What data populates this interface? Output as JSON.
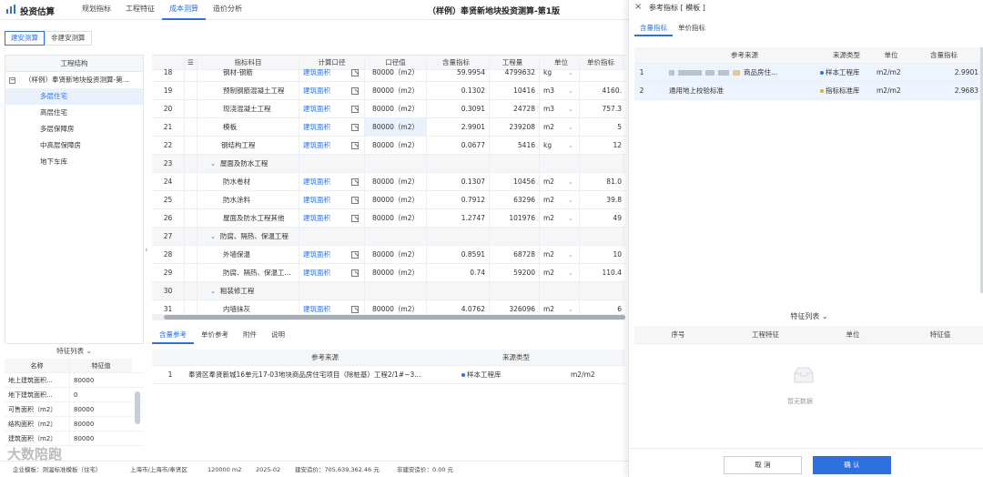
{
  "app": {
    "title": "投资估算",
    "nav": [
      "规划指标",
      "工程特征",
      "成本测算",
      "造价分析"
    ],
    "active_nav": 2,
    "doc_title": "（样例）奉贤新地块投资测算-第1版"
  },
  "subtabs": [
    "建安测算",
    "非建安测算"
  ],
  "tree": {
    "header": "工程结构",
    "root": "（样例）奉贤新地块投资测算-第...",
    "children": [
      "多层住宅",
      "高层住宅",
      "多层保障房",
      "中高层保障房",
      "地下车库"
    ]
  },
  "features": {
    "title": "特征列表",
    "col_name": "名称",
    "col_value": "特征值",
    "rows": [
      {
        "name": "地上建筑面积...",
        "value": "80000"
      },
      {
        "name": "地下建筑面积...",
        "value": "0"
      },
      {
        "name": "可售面积（m2）",
        "value": "80000"
      },
      {
        "name": "结构面积（m2）",
        "value": "80000"
      },
      {
        "name": "建筑面积（m2）",
        "value": "80000"
      }
    ]
  },
  "grid": {
    "headers": {
      "menu": "☰",
      "name": "指标科目",
      "calc": "计算口径",
      "value": "口径值",
      "index": "含量指标",
      "qty": "工程量",
      "unit": "单位",
      "price": "单价指标"
    },
    "rows": [
      {
        "no": "18",
        "name": "钢材-钢筋",
        "level": "lvl3",
        "calc": "建筑面积",
        "value": "80000（m2）",
        "index": "59.9954",
        "qty": "4799632",
        "unit": "kg",
        "price": ""
      },
      {
        "no": "19",
        "name": "预制钢筋混凝土工程",
        "level": "lvl3",
        "calc": "建筑面积",
        "value": "80000（m2）",
        "index": "0.1302",
        "qty": "10416",
        "unit": "m3",
        "price": "4160."
      },
      {
        "no": "20",
        "name": "现浇混凝土工程",
        "level": "lvl3",
        "calc": "建筑面积",
        "value": "80000（m2）",
        "index": "0.3091",
        "qty": "24728",
        "unit": "m3",
        "price": "757.3"
      },
      {
        "no": "21",
        "name": "模板",
        "level": "lvl3",
        "calc": "建筑面积",
        "value": "80000（m2）",
        "index": "2.9901",
        "qty": "239208",
        "unit": "m2",
        "price": "5"
      },
      {
        "no": "22",
        "name": "钢结构工程",
        "level": "lvl2",
        "calc": "建筑面积",
        "value": "80000（m2）",
        "index": "0.0677",
        "qty": "5416",
        "unit": "kg",
        "price": "12"
      },
      {
        "no": "23",
        "name": "屋面及防水工程",
        "level": "group",
        "calc": "",
        "value": "",
        "index": "",
        "qty": "",
        "unit": "",
        "price": ""
      },
      {
        "no": "24",
        "name": "防水卷材",
        "level": "lvl3",
        "calc": "建筑面积",
        "value": "80000（m2）",
        "index": "0.1307",
        "qty": "10456",
        "unit": "m2",
        "price": "81.0"
      },
      {
        "no": "25",
        "name": "防水涂料",
        "level": "lvl3",
        "calc": "建筑面积",
        "value": "80000（m2）",
        "index": "0.7912",
        "qty": "63296",
        "unit": "m2",
        "price": "39.8"
      },
      {
        "no": "26",
        "name": "屋面及防水工程其他",
        "level": "lvl3",
        "calc": "建筑面积",
        "value": "80000（m2）",
        "index": "1.2747",
        "qty": "101976",
        "unit": "m2",
        "price": "49"
      },
      {
        "no": "27",
        "name": "防腐、隔热、保温工程",
        "level": "group",
        "calc": "",
        "value": "",
        "index": "",
        "qty": "",
        "unit": "",
        "price": ""
      },
      {
        "no": "28",
        "name": "外墙保温",
        "level": "lvl3",
        "calc": "建筑面积",
        "value": "80000（m2）",
        "index": "0.8591",
        "qty": "68728",
        "unit": "m2",
        "price": "10"
      },
      {
        "no": "29",
        "name": "防腐、隔热、保温工...",
        "level": "lvl3",
        "calc": "建筑面积",
        "value": "80000（m2）",
        "index": "0.74",
        "qty": "59200",
        "unit": "m2",
        "price": "110.4"
      },
      {
        "no": "30",
        "name": "粗装修工程",
        "level": "group",
        "calc": "",
        "value": "",
        "index": "",
        "qty": "",
        "unit": "",
        "price": ""
      },
      {
        "no": "31",
        "name": "内墙抹灰",
        "level": "lvl3",
        "calc": "建筑面积",
        "value": "80000（m2）",
        "index": "4.0762",
        "qty": "326096",
        "unit": "m2",
        "price": "6"
      }
    ]
  },
  "bottom_tabs": [
    "含量参考",
    "单价参考",
    "附件",
    "说明"
  ],
  "bottom_table": {
    "headers": {
      "src": "参考来源",
      "type": "来源类型"
    },
    "rows": [
      {
        "no": "1",
        "src": "奉贤区奉贤新城16单元17-03地块商品房住宅项目（除桩基）工程2/1#~3...",
        "type": "样本工程库",
        "unit": "m2/m2"
      }
    ]
  },
  "status_bar": {
    "template": "企业模板：测温标准模板（住宅）",
    "location": "上海市/上海市/奉贤区",
    "area": "120000 m2",
    "date": "2025-02",
    "jian_an_label": "建安造价：",
    "jian_an_value": "705,639,362.46 元",
    "fei_jian_an_label": "非建安造价：",
    "fei_jian_an_value": "0.00 元"
  },
  "watermark": "大数陪跑",
  "ref_panel": {
    "title": "参考指标 [ 模板 ]",
    "tabs": [
      "含量指标",
      "单价指标"
    ],
    "headers": {
      "src": "参考来源",
      "type": "来源类型",
      "unit": "单位",
      "val": "含量指标"
    },
    "rows": [
      {
        "no": "1",
        "src": "商品房住...",
        "type": "样本工程库",
        "type_color": "#2f6fe0",
        "unit": "m2/m2",
        "val": "2.9901",
        "checked": true
      },
      {
        "no": "2",
        "src": "通用地上校验标准",
        "type": "指标标准库",
        "type_color": "#e0b21c",
        "unit": "m2/m2",
        "val": "2.9683",
        "checked": true
      }
    ],
    "feature_title": "特征列表",
    "feature_headers": [
      "序号",
      "工程特征",
      "单位",
      "特征值"
    ],
    "empty_text": "暂无数据",
    "cancel_label": "取 消",
    "ok_label": "确 认"
  }
}
